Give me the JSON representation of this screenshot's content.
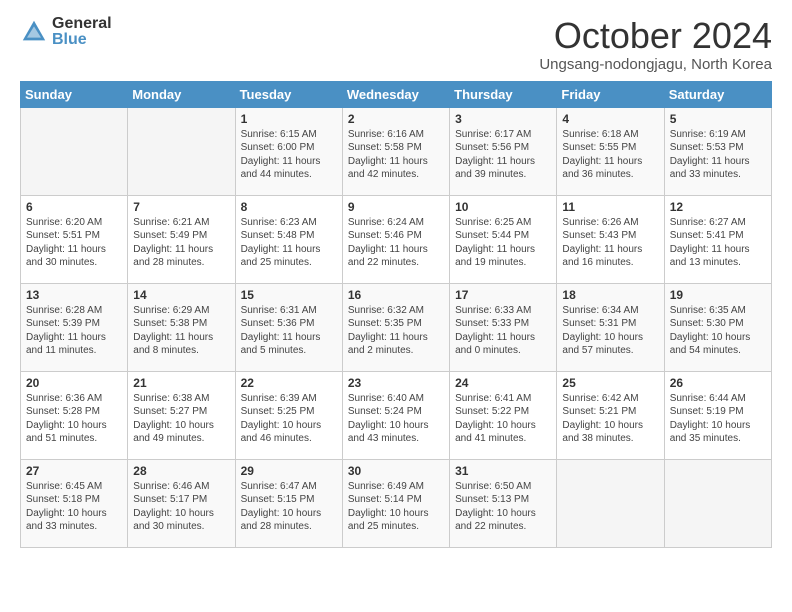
{
  "logo": {
    "general": "General",
    "blue": "Blue"
  },
  "title": "October 2024",
  "subtitle": "Ungsang-nodongjagu, North Korea",
  "days_header": [
    "Sunday",
    "Monday",
    "Tuesday",
    "Wednesday",
    "Thursday",
    "Friday",
    "Saturday"
  ],
  "weeks": [
    [
      {
        "day": "",
        "info": ""
      },
      {
        "day": "",
        "info": ""
      },
      {
        "day": "1",
        "info": "Sunrise: 6:15 AM\nSunset: 6:00 PM\nDaylight: 11 hours and 44 minutes."
      },
      {
        "day": "2",
        "info": "Sunrise: 6:16 AM\nSunset: 5:58 PM\nDaylight: 11 hours and 42 minutes."
      },
      {
        "day": "3",
        "info": "Sunrise: 6:17 AM\nSunset: 5:56 PM\nDaylight: 11 hours and 39 minutes."
      },
      {
        "day": "4",
        "info": "Sunrise: 6:18 AM\nSunset: 5:55 PM\nDaylight: 11 hours and 36 minutes."
      },
      {
        "day": "5",
        "info": "Sunrise: 6:19 AM\nSunset: 5:53 PM\nDaylight: 11 hours and 33 minutes."
      }
    ],
    [
      {
        "day": "6",
        "info": "Sunrise: 6:20 AM\nSunset: 5:51 PM\nDaylight: 11 hours and 30 minutes."
      },
      {
        "day": "7",
        "info": "Sunrise: 6:21 AM\nSunset: 5:49 PM\nDaylight: 11 hours and 28 minutes."
      },
      {
        "day": "8",
        "info": "Sunrise: 6:23 AM\nSunset: 5:48 PM\nDaylight: 11 hours and 25 minutes."
      },
      {
        "day": "9",
        "info": "Sunrise: 6:24 AM\nSunset: 5:46 PM\nDaylight: 11 hours and 22 minutes."
      },
      {
        "day": "10",
        "info": "Sunrise: 6:25 AM\nSunset: 5:44 PM\nDaylight: 11 hours and 19 minutes."
      },
      {
        "day": "11",
        "info": "Sunrise: 6:26 AM\nSunset: 5:43 PM\nDaylight: 11 hours and 16 minutes."
      },
      {
        "day": "12",
        "info": "Sunrise: 6:27 AM\nSunset: 5:41 PM\nDaylight: 11 hours and 13 minutes."
      }
    ],
    [
      {
        "day": "13",
        "info": "Sunrise: 6:28 AM\nSunset: 5:39 PM\nDaylight: 11 hours and 11 minutes."
      },
      {
        "day": "14",
        "info": "Sunrise: 6:29 AM\nSunset: 5:38 PM\nDaylight: 11 hours and 8 minutes."
      },
      {
        "day": "15",
        "info": "Sunrise: 6:31 AM\nSunset: 5:36 PM\nDaylight: 11 hours and 5 minutes."
      },
      {
        "day": "16",
        "info": "Sunrise: 6:32 AM\nSunset: 5:35 PM\nDaylight: 11 hours and 2 minutes."
      },
      {
        "day": "17",
        "info": "Sunrise: 6:33 AM\nSunset: 5:33 PM\nDaylight: 11 hours and 0 minutes."
      },
      {
        "day": "18",
        "info": "Sunrise: 6:34 AM\nSunset: 5:31 PM\nDaylight: 10 hours and 57 minutes."
      },
      {
        "day": "19",
        "info": "Sunrise: 6:35 AM\nSunset: 5:30 PM\nDaylight: 10 hours and 54 minutes."
      }
    ],
    [
      {
        "day": "20",
        "info": "Sunrise: 6:36 AM\nSunset: 5:28 PM\nDaylight: 10 hours and 51 minutes."
      },
      {
        "day": "21",
        "info": "Sunrise: 6:38 AM\nSunset: 5:27 PM\nDaylight: 10 hours and 49 minutes."
      },
      {
        "day": "22",
        "info": "Sunrise: 6:39 AM\nSunset: 5:25 PM\nDaylight: 10 hours and 46 minutes."
      },
      {
        "day": "23",
        "info": "Sunrise: 6:40 AM\nSunset: 5:24 PM\nDaylight: 10 hours and 43 minutes."
      },
      {
        "day": "24",
        "info": "Sunrise: 6:41 AM\nSunset: 5:22 PM\nDaylight: 10 hours and 41 minutes."
      },
      {
        "day": "25",
        "info": "Sunrise: 6:42 AM\nSunset: 5:21 PM\nDaylight: 10 hours and 38 minutes."
      },
      {
        "day": "26",
        "info": "Sunrise: 6:44 AM\nSunset: 5:19 PM\nDaylight: 10 hours and 35 minutes."
      }
    ],
    [
      {
        "day": "27",
        "info": "Sunrise: 6:45 AM\nSunset: 5:18 PM\nDaylight: 10 hours and 33 minutes."
      },
      {
        "day": "28",
        "info": "Sunrise: 6:46 AM\nSunset: 5:17 PM\nDaylight: 10 hours and 30 minutes."
      },
      {
        "day": "29",
        "info": "Sunrise: 6:47 AM\nSunset: 5:15 PM\nDaylight: 10 hours and 28 minutes."
      },
      {
        "day": "30",
        "info": "Sunrise: 6:49 AM\nSunset: 5:14 PM\nDaylight: 10 hours and 25 minutes."
      },
      {
        "day": "31",
        "info": "Sunrise: 6:50 AM\nSunset: 5:13 PM\nDaylight: 10 hours and 22 minutes."
      },
      {
        "day": "",
        "info": ""
      },
      {
        "day": "",
        "info": ""
      }
    ]
  ]
}
